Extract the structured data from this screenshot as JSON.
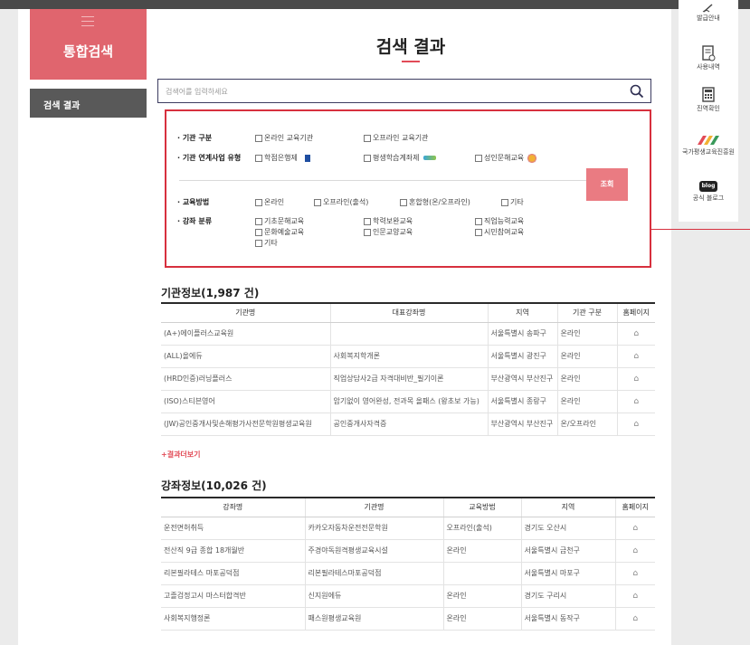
{
  "sidebar": {
    "title": "통합검색",
    "nav_item": "검색 결과"
  },
  "main": {
    "title": "검색 결과"
  },
  "search": {
    "placeholder": "검색어를 입력하세요"
  },
  "filter": {
    "org_type_label": "· 기관 구분",
    "org_type_options": [
      "온라인 교육기관",
      "오프라인 교육기관"
    ],
    "link_label": "· 기관 연계사업 유형",
    "link_options": [
      "학점은행제",
      "평생학습계좌제",
      "성인문해교육"
    ],
    "method_label": "· 교육방법",
    "method_options": [
      "온라인",
      "오프라인(출석)",
      "혼합형(온/오프라인)",
      "기타"
    ],
    "category_label": "· 강좌 분류",
    "category_options": [
      "기초문해교육",
      "학력보완교육",
      "직업능력교육",
      "문화예술교육",
      "인문교양교육",
      "시민참여교육",
      "기타"
    ],
    "submit_label": "조회"
  },
  "institutions": {
    "title": "기관정보(1,987 건)",
    "headers": [
      "기관명",
      "대표강좌명",
      "지역",
      "기관 구분",
      "홈페이지"
    ],
    "rows": [
      [
        "(A+)에이플러스교육원",
        "",
        "서울특별시 송파구",
        "온라인"
      ],
      [
        "(ALL)올에듀",
        "사회복지학개론",
        "서울특별시 광진구",
        "온라인"
      ],
      [
        "(HRD인증)러닝플러스",
        "직업상담사2급 자격대비반_필기이론",
        "부산광역시 부산진구",
        "온라인"
      ],
      [
        "(ISO)스티븐영어",
        "암기없이 영어완성, 전과목 올패스 (왕초보 가능)",
        "서울특별시 종랑구",
        "온라인"
      ],
      [
        "(JW)공인중개사및손해평가사전문학원평생교육원",
        "공인중개사자격증",
        "부산광역시 부산진구",
        "온/오프라인"
      ]
    ],
    "more_label": "+결과더보기"
  },
  "courses": {
    "title": "강좌정보(10,026 건)",
    "headers": [
      "강좌명",
      "기관명",
      "교육방법",
      "지역",
      "홈페이지"
    ],
    "rows": [
      [
        "운전면허취득",
        "카카오자동차운전전문학원",
        "오프라인(출석)",
        "경기도 오산시"
      ],
      [
        "전산직 9급 종합 18개월반",
        "주경야독원격평생교육시설",
        "온라인",
        "서울특별시 금천구"
      ],
      [
        "리본필라테스 마포공덕점",
        "리본필라테스마포공덕점",
        "",
        "서울특별시 마포구"
      ],
      [
        "고졸검정고시 마스터합격반",
        "신지원에듀",
        "온라인",
        "경기도 구리시"
      ],
      [
        "사회복지행정론",
        "패스원평생교육원",
        "온라인",
        "서울특별시 동작구"
      ]
    ]
  },
  "quickbar": {
    "items": [
      "발급안내",
      "사용내역",
      "진역확인",
      "국가평생교육진흥원",
      "공식 블로그"
    ],
    "blog_badge": "blog"
  },
  "colors": {
    "accent": "#e0656e",
    "border_accent": "#d7303e"
  },
  "icons": {
    "home": "home-icon",
    "search": "search-icon"
  }
}
